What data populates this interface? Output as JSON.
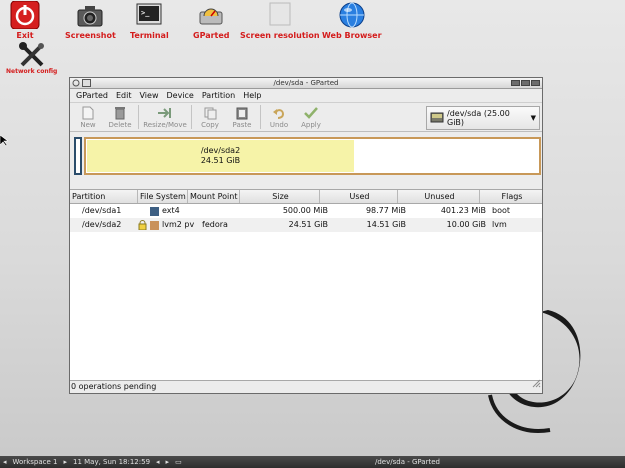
{
  "desktop": {
    "icons": [
      {
        "name": "exit",
        "label": "Exit"
      },
      {
        "name": "screenshot",
        "label": "Screenshot"
      },
      {
        "name": "terminal",
        "label": "Terminal"
      },
      {
        "name": "gparted",
        "label": "GParted"
      },
      {
        "name": "screen-resolution",
        "label": "Screen resolution"
      },
      {
        "name": "web-browser",
        "label": "Web Browser"
      },
      {
        "name": "network-config",
        "label": "Network config"
      }
    ]
  },
  "window": {
    "title": "/dev/sda - GParted",
    "menu": [
      "GParted",
      "Edit",
      "View",
      "Device",
      "Partition",
      "Help"
    ],
    "toolbar": {
      "new": "New",
      "delete": "Delete",
      "resize_move": "Resize/Move",
      "copy": "Copy",
      "paste": "Paste",
      "undo": "Undo",
      "apply": "Apply"
    },
    "device_selector": "/dev/sda  (25.00 GiB)",
    "diskmap": {
      "partition_name": "/dev/sda2",
      "partition_size": "24.51 GiB"
    },
    "table": {
      "columns": [
        "Partition",
        "File System",
        "Mount Point",
        "Size",
        "Used",
        "Unused",
        "Flags"
      ],
      "rows": [
        {
          "partition": "/dev/sda1",
          "filesystem": "ext4",
          "fs_color": "#3d5f83",
          "mount": "",
          "size": "500.00 MiB",
          "used": "98.77 MiB",
          "unused": "401.23 MiB",
          "flags": "boot",
          "locked": false
        },
        {
          "partition": "/dev/sda2",
          "filesystem": "lvm2 pv",
          "fs_color": "#c9915a",
          "mount": "fedora",
          "size": "24.51 GiB",
          "used": "14.51 GiB",
          "unused": "10.00 GiB",
          "flags": "lvm",
          "locked": true
        }
      ]
    },
    "status": "0 operations pending"
  },
  "taskbar": {
    "workspace": "Workspace 1",
    "clock": "11 May, Sun 18:12:59",
    "task": "/dev/sda - GParted"
  }
}
